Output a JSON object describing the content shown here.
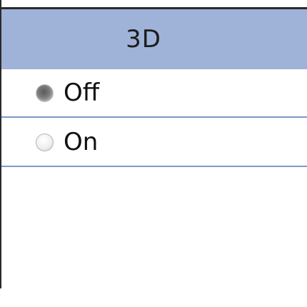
{
  "panel": {
    "title": "3D",
    "options": [
      {
        "label": "Off",
        "selected": true
      },
      {
        "label": "On",
        "selected": false
      }
    ]
  },
  "colors": {
    "header_bg": "#9fb2d8",
    "separator": "#7f98c6",
    "border": "#2a2a2a"
  }
}
